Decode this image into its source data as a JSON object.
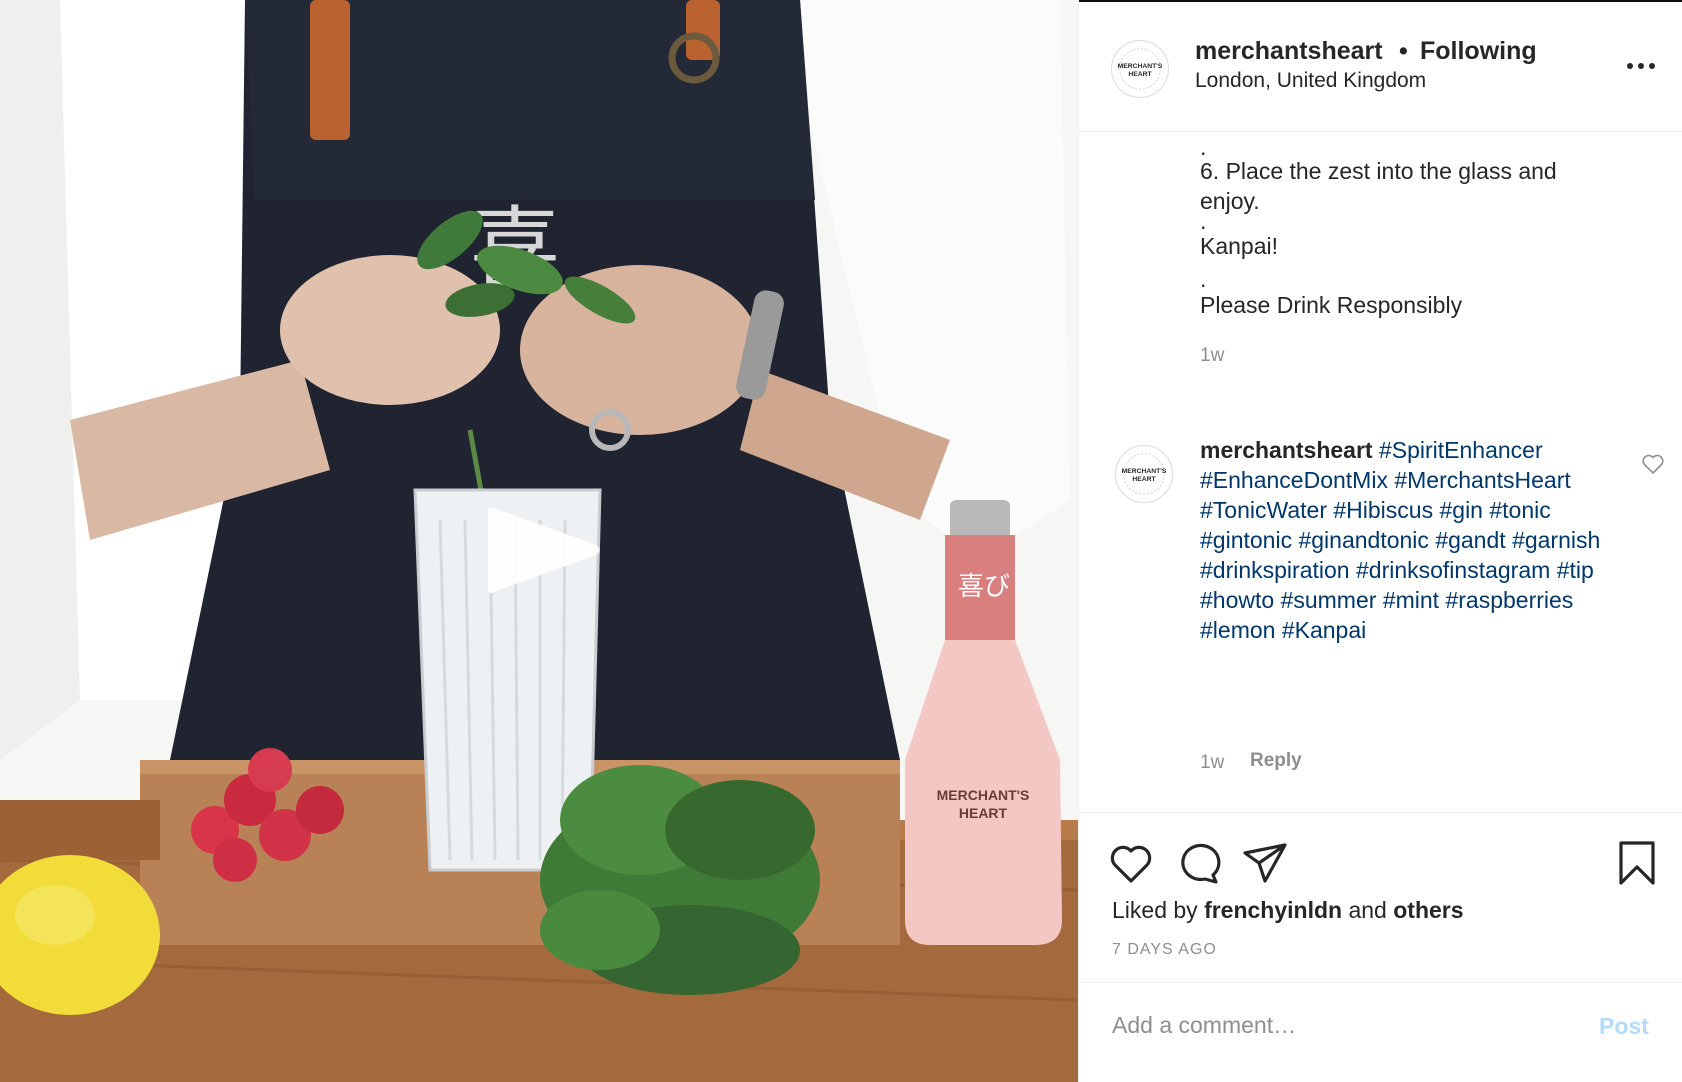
{
  "post": {
    "header": {
      "username": "merchantsheart",
      "separator": "•",
      "follow_state": "Following",
      "location": "London, United Kingdom",
      "avatar_text_line1": "MERCHANT'S",
      "avatar_text_line2": "HEART",
      "more_icon": "more-options-icon"
    },
    "media": {
      "type": "video",
      "play_icon": "play-icon",
      "bottle_label_line1": "MERCHANT'S",
      "bottle_label_line2": "HEART",
      "bottle_kanji": "喜び",
      "apron_glyph": "喜"
    },
    "caption_tail": {
      "lines": [
        ".",
        "6. Place the zest into the glass and",
        "enjoy.",
        ".",
        "Kanpai!",
        ".",
        "Please Drink Responsibly"
      ],
      "timestamp": "1w"
    },
    "comment": {
      "username": "merchantsheart",
      "hashtags": [
        "#SpiritEnhancer",
        "#EnhanceDontMix",
        "#MerchantsHeart",
        "#TonicWater",
        "#Hibiscus",
        "#gin",
        "#tonic",
        "#gintonic",
        "#ginandtonic",
        "#gandt",
        "#garnish",
        "#drinkspiration",
        "#drinksofinstagram",
        "#tip",
        "#howto",
        "#summer",
        "#mint",
        "#raspberries",
        "#lemon",
        "#Kanpai"
      ],
      "timestamp": "1w",
      "reply_label": "Reply"
    },
    "actions": {
      "like_icon": "heart-icon",
      "comment_icon": "comment-icon",
      "share_icon": "share-icon",
      "save_icon": "bookmark-icon"
    },
    "likes": {
      "prefix": "Liked by",
      "user": "frenchyinldn",
      "conjunction": "and",
      "others": "others"
    },
    "date": "7 DAYS AGO",
    "add_comment": {
      "placeholder": "Add a comment…",
      "post_label": "Post"
    }
  },
  "colors": {
    "hashtag": "#00376b",
    "muted": "#8e8e8e",
    "post_button_disabled": "#b3dbff",
    "text": "#262626",
    "border": "#efefef"
  }
}
